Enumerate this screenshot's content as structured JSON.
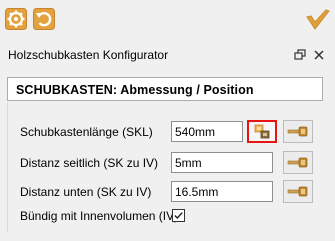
{
  "toolbar": {
    "icons": [
      "settings-gear-icon",
      "reset-icon",
      "accept-check-icon"
    ],
    "accent_color": "#e0a03c"
  },
  "panel": {
    "title": "Holzschubkasten Konfigurator",
    "float_icon": "float-window-icon",
    "close_icon": "close-icon"
  },
  "section": {
    "title": "SCHUBKASTEN: Abmessung / Position"
  },
  "rows": {
    "skl": {
      "label": "Schubkastenlänge (SKL)",
      "value": "540mm",
      "picker_icon": "pick-from-model-icon",
      "measure_icon": "measure-tape-icon"
    },
    "distance_side": {
      "label": "Distanz seitlich (SK zu IV)",
      "value": "5mm",
      "measure_icon": "measure-tape-icon"
    },
    "distance_bottom": {
      "label": "Distanz unten (SK zu IV)",
      "value": "16.5mm",
      "measure_icon": "measure-tape-icon"
    },
    "flush": {
      "label": "Bündig mit Innenvolumen (IV)",
      "checked": true
    }
  },
  "highlight_color": "#e81313"
}
